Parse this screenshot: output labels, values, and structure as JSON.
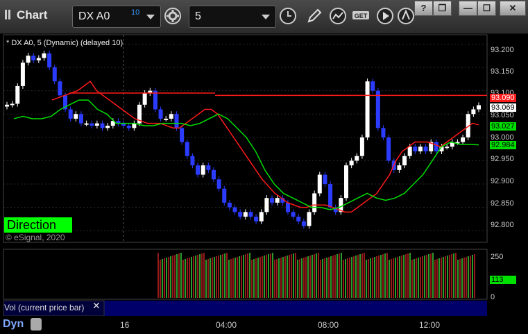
{
  "app": {
    "title": "Chart"
  },
  "toolbar": {
    "symbol": "DX A0",
    "delay_badge": "10",
    "interval": "5",
    "buttons": [
      "gear-icon",
      "clock-icon",
      "pencil-icon",
      "study-icon",
      "get-icon",
      "play-icon",
      "link-icon"
    ]
  },
  "window_buttons": {
    "help": "?",
    "restore": "❐",
    "minimize": "—",
    "maximize": "☐",
    "close": "✕"
  },
  "chart": {
    "study_label": "* DX A0, 5 (Dynamic) (delayed 10)",
    "direction_label": "Direction",
    "copyright": "© eSignal, 2020",
    "price_ticks": [
      "93.200",
      "93.150",
      "93.100",
      "93.050",
      "93.000",
      "92.950",
      "92.900",
      "92.850",
      "92.800"
    ],
    "tags": {
      "red": "93.090",
      "last": "93.069",
      "green_up": "93.027",
      "green_line": "92.984"
    },
    "colors": {
      "up": "#ffffff",
      "down": "#2b3cff",
      "red_line": "#ff1a1a",
      "green_line": "#00e000"
    }
  },
  "volume": {
    "label": "Vol (current price bar)",
    "close": "✕",
    "ticks": [
      "250",
      "0"
    ],
    "last_tag": "113"
  },
  "time_axis": {
    "labels": [
      "16",
      "04:00",
      "08:00",
      "12:00"
    ]
  },
  "bottom": {
    "mode": "Dyn"
  },
  "chart_data": {
    "type": "candlestick",
    "title": "",
    "ylim": [
      92.775,
      93.22
    ],
    "price_ticks": [
      93.2,
      93.15,
      93.1,
      93.05,
      93.0,
      92.95,
      92.9,
      92.85,
      92.8
    ],
    "x_labels": [
      "16",
      "04:00",
      "08:00",
      "12:00"
    ],
    "series": [
      {
        "name": "",
        "values": [
          93.07,
          93.072,
          93.11,
          93.16,
          93.175,
          93.165,
          93.17,
          93.18,
          93.15,
          93.12,
          93.09,
          93.06,
          93.04,
          93.05,
          93.03,
          93.03,
          93.025,
          93.03,
          93.02,
          93.025,
          93.035,
          93.03,
          93.025,
          93.02,
          93.03,
          93.07,
          93.095,
          93.1,
          93.06,
          93.04,
          93.04,
          93.05,
          93.02,
          92.99,
          92.96,
          92.94,
          92.92,
          92.94,
          92.93,
          92.91,
          92.89,
          92.86,
          92.85,
          92.84,
          92.83,
          92.84,
          92.83,
          92.82,
          92.84,
          92.87,
          92.86,
          92.87,
          92.86,
          92.84,
          92.83,
          92.82,
          92.81,
          92.84,
          92.88,
          92.92,
          92.9,
          92.85,
          92.84,
          92.87,
          92.94,
          92.95,
          92.96,
          93.0,
          93.12,
          93.1,
          93.02,
          93.0,
          92.95,
          92.93,
          92.94,
          92.96,
          92.98,
          92.97,
          92.98,
          92.97,
          92.99,
          92.97,
          92.98,
          92.98,
          92.99,
          92.99,
          93.0,
          93.05,
          93.06,
          93.069
        ]
      },
      {
        "name": "",
        "values": [
          93.08,
          93.085,
          93.09,
          93.095,
          93.1,
          93.11,
          93.12,
          93.1,
          93.09,
          93.08,
          93.07,
          93.06,
          93.05,
          93.04,
          93.035,
          93.03,
          93.03,
          93.03,
          93.025,
          93.02,
          93.02,
          93.03,
          93.04,
          93.05,
          93.06,
          93.06,
          93.05,
          93.03,
          93.01,
          92.99,
          92.97,
          92.95,
          92.93,
          92.91,
          92.895,
          92.88,
          92.87,
          92.86,
          92.855,
          92.85,
          92.85,
          92.855,
          92.855,
          92.855,
          92.85,
          92.845,
          92.84,
          92.84,
          92.85,
          92.86,
          92.87,
          92.88,
          92.9,
          92.92,
          92.95,
          92.97,
          92.98,
          92.99,
          92.99,
          92.99,
          92.985,
          92.98,
          92.99,
          93.0,
          93.01,
          93.02,
          93.03,
          93.027
        ]
      },
      {
        "name": "",
        "values": [
          93.04,
          93.045,
          93.04,
          93.04,
          93.045,
          93.06,
          93.07,
          93.08,
          93.08,
          93.06,
          93.05,
          93.03,
          93.03,
          93.03,
          93.025,
          93.025,
          93.03,
          93.03,
          93.03,
          93.025,
          93.03,
          93.04,
          93.05,
          93.04,
          93.02,
          93.0,
          92.97,
          92.93,
          92.9,
          92.88,
          92.87,
          92.86,
          92.85,
          92.85,
          92.845,
          92.85,
          92.86,
          92.87,
          92.88,
          92.87,
          92.865,
          92.87,
          92.88,
          92.9,
          92.92,
          92.95,
          92.98,
          92.99,
          92.985,
          92.985,
          92.984
        ]
      }
    ]
  }
}
